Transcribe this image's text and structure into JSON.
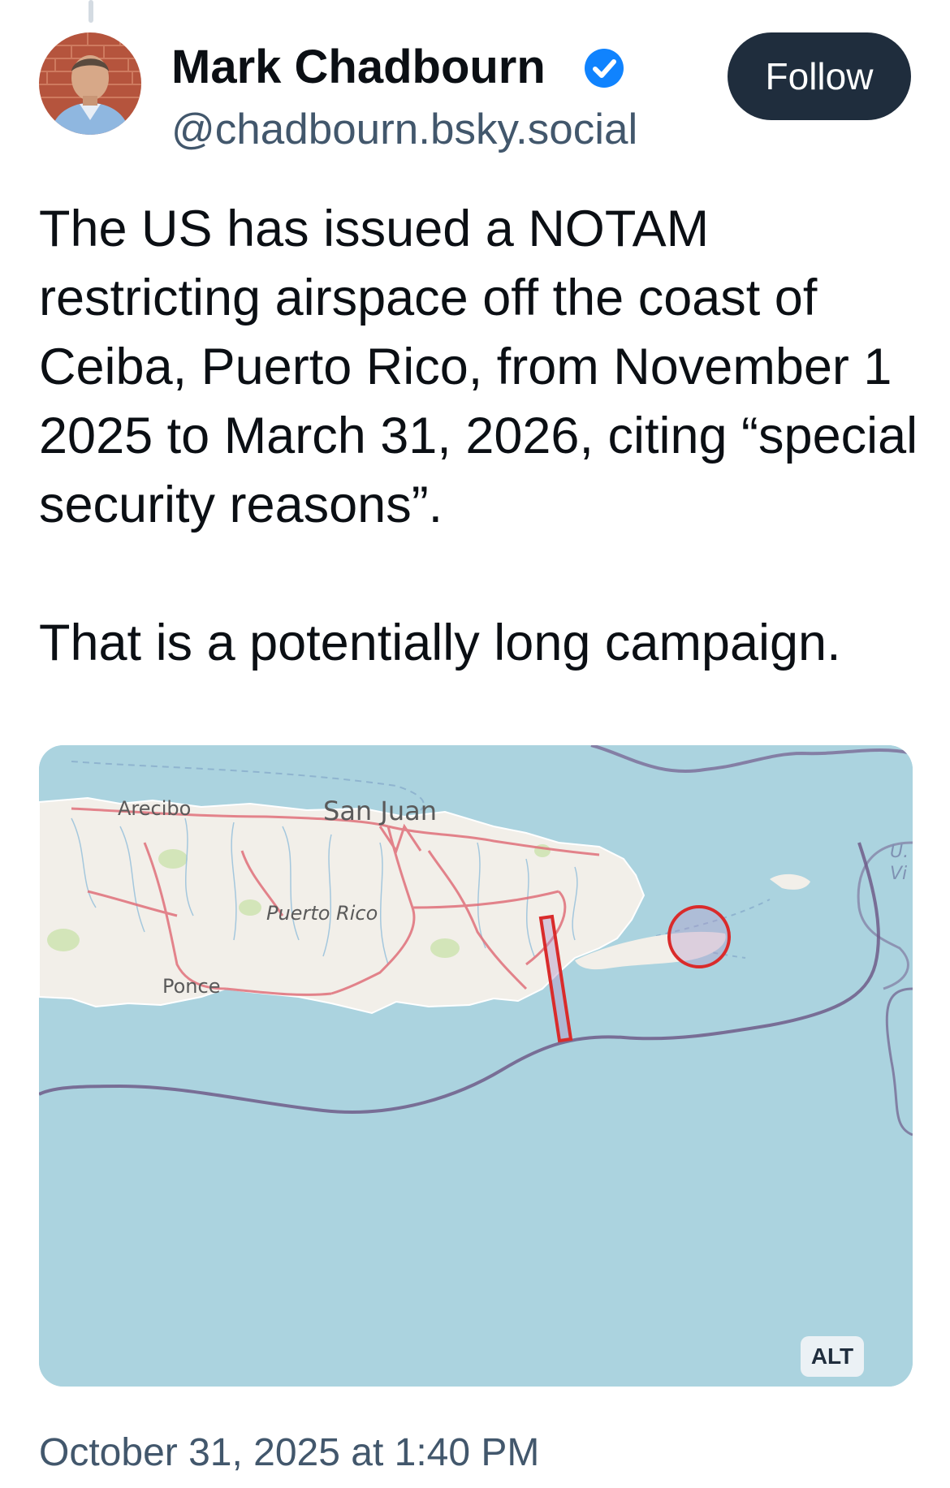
{
  "post": {
    "author": {
      "display_name": "Mark Chadbourn",
      "handle": "@chadbourn.bsky.social",
      "verified": true,
      "avatar_icon": "profile-photo",
      "verified_icon": "verified-check-icon"
    },
    "follow_label": "Follow",
    "paragraphs": [
      "The US has issued a NOTAM restricting airspace off the coast of Ceiba, Puerto Rico, from November 1 2025 to March 31, 2026, citing “special security reasons”.",
      "That is a potentially long campaign."
    ],
    "timestamp": "October 31, 2025 at 1:40 PM"
  },
  "map": {
    "labels": {
      "arecibo": "Arecibo",
      "san_juan": "San Juan",
      "puerto_rico": "Puerto Rico",
      "ponce": "Ponce",
      "edge_top": "U.",
      "edge_bottom": "Vi"
    },
    "alt_label": "ALT",
    "colors": {
      "water": "#abd3df",
      "land": "#f2efe9",
      "roads": "#e0707a",
      "maritime_boundary": "#6f5c8a",
      "restricted_zone": "#d92b2b"
    }
  }
}
